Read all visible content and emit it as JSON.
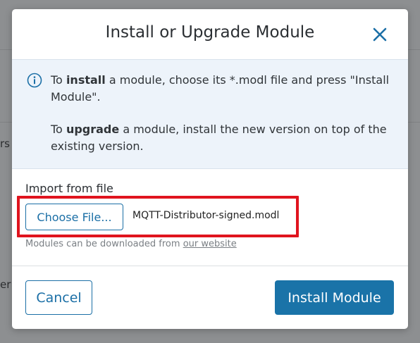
{
  "background": {
    "fragment_1": "rs",
    "fragment_2": "er"
  },
  "dialog": {
    "title": "Install or Upgrade Module",
    "close_icon": "close-icon"
  },
  "info": {
    "icon": "info-icon",
    "install_prefix": "To ",
    "install_word": "install",
    "install_rest": " a module, choose its *.modl file and press \"Install Module\".",
    "upgrade_prefix": "To ",
    "upgrade_word": "upgrade",
    "upgrade_rest": " a module, install the new version on top of the existing version."
  },
  "import": {
    "label": "Import from file",
    "choose_button": "Choose File...",
    "selected_file": "MQTT-Distributor-signed.modl",
    "hint_text": "Modules can be downloaded from ",
    "hint_link": "our website"
  },
  "footer": {
    "cancel_label": "Cancel",
    "install_label": "Install Module"
  },
  "colors": {
    "accent": "#1a73a8",
    "highlight": "#e0141e",
    "info_bg": "#edf3fa"
  }
}
